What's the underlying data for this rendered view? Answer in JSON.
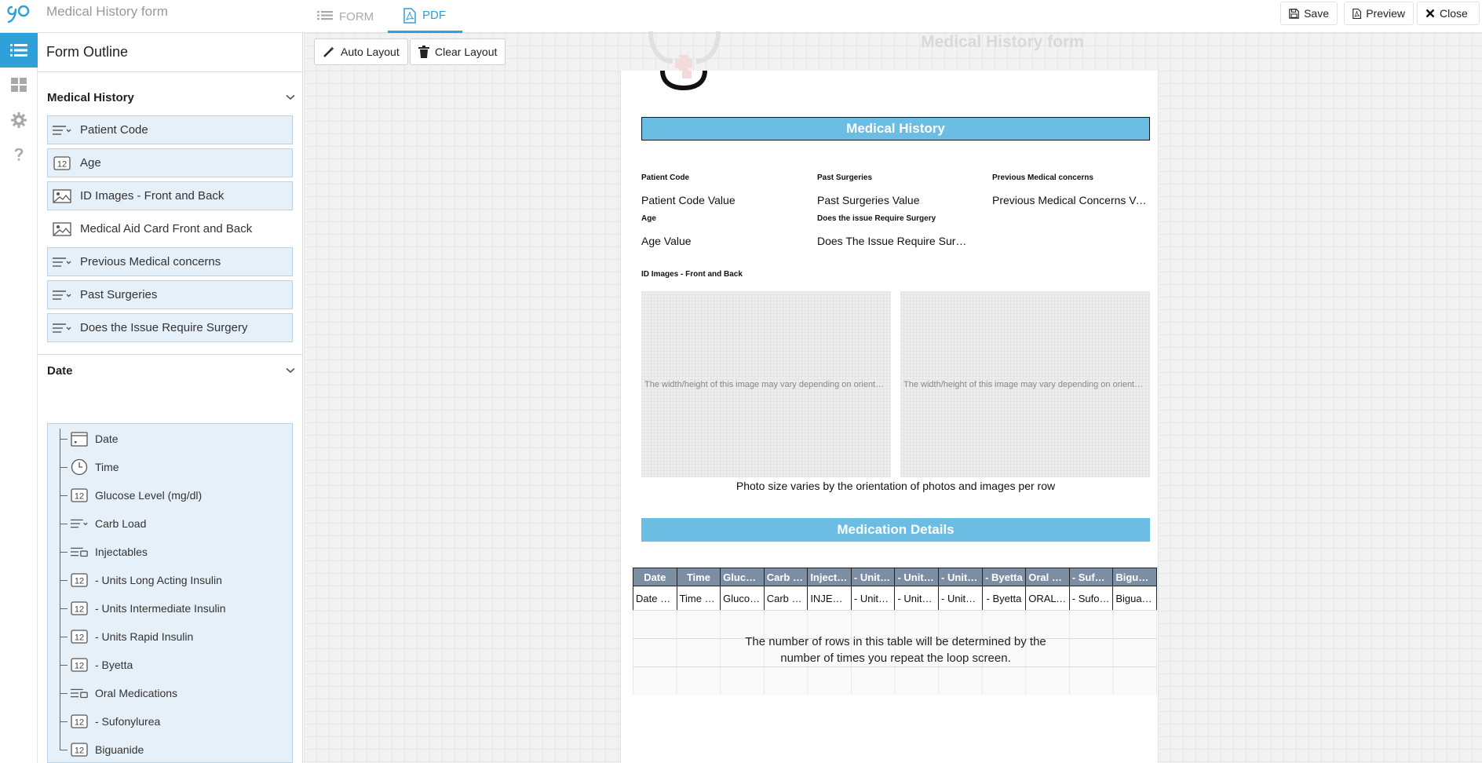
{
  "app": {
    "title": "Medical History form",
    "tabs": {
      "form": "FORM",
      "pdf": "PDF"
    },
    "actions": {
      "save": "Save",
      "preview": "Preview",
      "close": "Close"
    },
    "accent": "#2f9fd8"
  },
  "outline": {
    "header": "Form Outline",
    "sections": [
      {
        "title": "Medical History",
        "items": [
          {
            "label": "Patient Code",
            "icon": "dropdown-text-icon"
          },
          {
            "label": "Age",
            "icon": "number-icon"
          },
          {
            "label": "ID Images - Front and Back",
            "icon": "image-icon"
          },
          {
            "label": "Medical Aid Card Front and Back",
            "icon": "image-icon"
          },
          {
            "label": "Previous Medical concerns",
            "icon": "dropdown-text-icon"
          },
          {
            "label": "Past Surgeries",
            "icon": "dropdown-text-icon"
          },
          {
            "label": "Does the Issue Require Surgery",
            "icon": "dropdown-text-icon"
          }
        ]
      },
      {
        "title": "Date",
        "items": [
          {
            "label": "Date",
            "icon": "calendar-icon"
          },
          {
            "label": "Time",
            "icon": "clock-icon"
          },
          {
            "label": "Glucose Level (mg/dl)",
            "icon": "number-icon"
          },
          {
            "label": "Carb Load",
            "icon": "dropdown-text-icon"
          },
          {
            "label": "Injectables",
            "icon": "checklist-icon"
          },
          {
            "label": "- Units Long Acting Insulin",
            "icon": "number-icon"
          },
          {
            "label": "- Units Intermediate Insulin",
            "icon": "number-icon"
          },
          {
            "label": "- Units Rapid Insulin",
            "icon": "number-icon"
          },
          {
            "label": "- Byetta",
            "icon": "number-icon"
          },
          {
            "label": "Oral Medications",
            "icon": "checklist-icon"
          },
          {
            "label": "- Sufonylurea",
            "icon": "number-icon"
          },
          {
            "label": "Biguanide",
            "icon": "number-icon"
          }
        ]
      }
    ]
  },
  "toolbar": {
    "auto_layout": "Auto Layout",
    "clear_layout": "Clear Layout"
  },
  "document": {
    "title": "Medical History form",
    "section1": "Medical History",
    "fields": [
      {
        "label": "Patient Code",
        "value": "Patient Code Value"
      },
      {
        "label": "Past Surgeries",
        "value": "Past Surgeries Value"
      },
      {
        "label": "Previous Medical concerns",
        "value": "Previous Medical Concerns Value"
      },
      {
        "label": "Age",
        "value": "Age Value"
      },
      {
        "label": "Does the issue Require Surgery",
        "value": "Does The Issue Require Surgery Value"
      }
    ],
    "images_label": "ID Images - Front and Back",
    "image_placeholder": "The width/height of this image may vary depending on orientation",
    "photo_note": "Photo size varies by the orientation of photos and images per row",
    "section2": "Medication Details",
    "table": {
      "headers": [
        "Date",
        "Time",
        "Glucose Level (mg/dl)",
        "Carb Load",
        "Injectables",
        "- Units Long Acting Insulin",
        "- Units Intermediate Insulin",
        "- Units Rapid Insulin",
        "- Byetta",
        "Oral Medications",
        "- Sufonylurea",
        "Biguanide"
      ],
      "row": [
        "Date Value",
        "Time Value",
        "Glucose Level Value",
        "Carb Load Value",
        "INJECTABLES",
        "- Units Long Acting Insulin",
        "- Units Intermediate Insulin",
        "- Units Rapid Insulin",
        "- Byetta",
        "ORAL MEDICATIONS",
        "- Sufonylurea",
        "Biguanide"
      ],
      "note": "The number of rows in this table will be determined by the number of times you repeat the loop screen."
    },
    "banner_color": "#6bbde3",
    "table_header_color": "#7c8ea3"
  }
}
